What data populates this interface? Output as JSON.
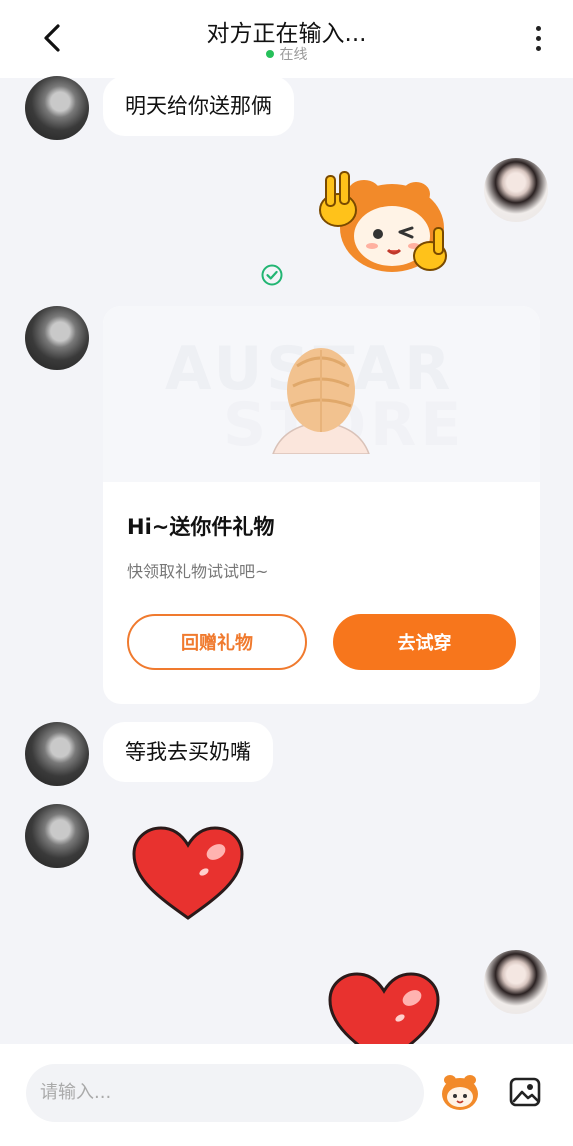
{
  "header": {
    "title": "对方正在输入...",
    "status": "在线",
    "status_color": "#26c05a"
  },
  "messages": {
    "msg1_text": "明天给你送那俩",
    "msg_sticker_right": "orange-mascot-wink-sticker",
    "gift_card": {
      "title": "Hi~送你件礼物",
      "subtitle": "快领取礼物试试吧~",
      "watermark_line1": "AUSTAR",
      "watermark_line2": "STORE",
      "return_gift_label": "回赠礼物",
      "try_on_label": "去试穿",
      "accent_color": "#f7761c"
    },
    "msg2_text": "等我去买奶嘴",
    "heart_left": "red-heart-sticker",
    "heart_right": "red-heart-sticker"
  },
  "composer": {
    "placeholder": "请输入..."
  }
}
